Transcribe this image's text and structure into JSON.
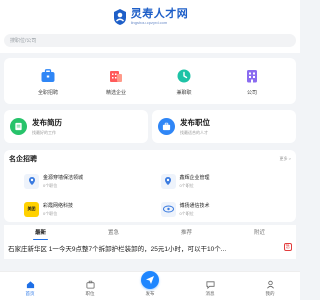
{
  "header": {
    "logo_title": "灵寿人才网",
    "logo_url": "lingshou.cpzyrd.com"
  },
  "search": {
    "placeholder": "搜职位/公司"
  },
  "quick": [
    {
      "label": "全职招聘",
      "icon": "briefcase-icon"
    },
    {
      "label": "精选企业",
      "icon": "enterprise-icon"
    },
    {
      "label": "兼聊职",
      "icon": "clock-icon"
    },
    {
      "label": "公司",
      "icon": "building-icon"
    }
  ],
  "publish": {
    "resume": {
      "title": "发布简历",
      "sub": "找最好的工作"
    },
    "job": {
      "title": "发布职位",
      "sub": "找最适合的人才"
    }
  },
  "famous": {
    "title": "名企招聘",
    "more": "更多 >",
    "companies": [
      {
        "name": "金源穿墙保洁领城",
        "sub": "0个职位",
        "logo": ""
      },
      {
        "name": "鑫辉企业管理",
        "sub": "0个职位",
        "logo": ""
      },
      {
        "name": "彩霞网络科技",
        "sub": "0个职位",
        "logo": "美团"
      },
      {
        "name": "博扬通信技术",
        "sub": "0个职位",
        "logo": ""
      }
    ]
  },
  "tabs": [
    "最新",
    "置急",
    "推荐",
    "附近"
  ],
  "feed": {
    "title": "石家庄新华区 1一今天9点整7个拆卸护栏装卸的，25元1小时，可以干10个...",
    "badge": "急"
  },
  "tabbar": [
    {
      "label": "首页"
    },
    {
      "label": "职位"
    },
    {
      "label": "发布"
    },
    {
      "label": "消息"
    },
    {
      "label": "我的"
    }
  ],
  "colors": {
    "primary": "#1e6fe6",
    "accent_red": "#e23c3c"
  }
}
